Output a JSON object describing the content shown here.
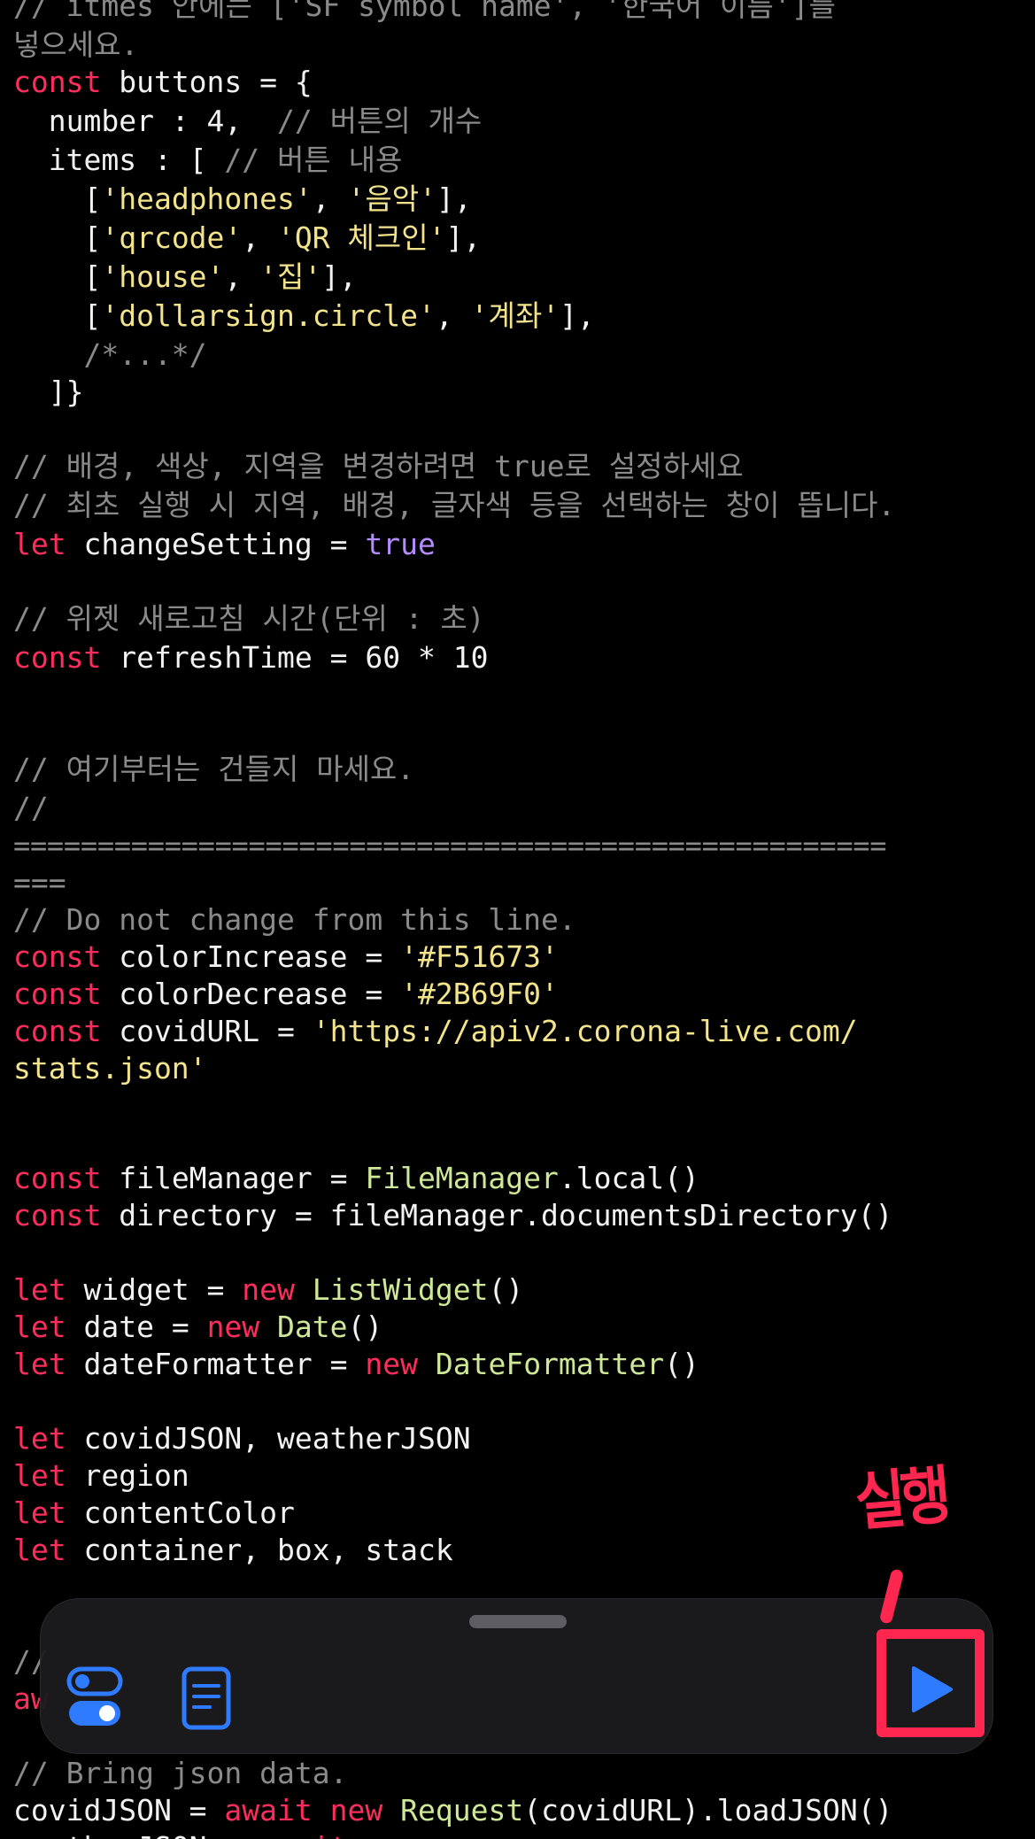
{
  "code": {
    "l01_cmt": "// itmes 안에는 ['SF symbol name', '한국어 이름']를",
    "l02_cmt": "넣으세요.",
    "l03_kw": "const",
    "l03_rest": " buttons = {",
    "l04_plain": "  number : 4,  ",
    "l04_cmt": "// 버튼의 개수",
    "l05_plain": "  items : [ ",
    "l05_cmt": "// 버튼 내용",
    "l06_a": "    [",
    "l06_s1": "'headphones'",
    "l06_b": ", ",
    "l06_s2": "'음악'",
    "l06_c": "],",
    "l07_a": "    [",
    "l07_s1": "'qrcode'",
    "l07_b": ", ",
    "l07_s2": "'QR 체크인'",
    "l07_c": "],",
    "l08_a": "    [",
    "l08_s1": "'house'",
    "l08_b": ", ",
    "l08_s2": "'집'",
    "l08_c": "],",
    "l09_a": "    [",
    "l09_s1": "'dollarsign.circle'",
    "l09_b": ", ",
    "l09_s2": "'계좌'",
    "l09_c": "],",
    "l10_cmt": "    /*...*/",
    "l11_plain": "  ]}",
    "l12_cmt": "// 배경, 색상, 지역을 변경하려면 true로 설정하세요",
    "l13_cmt": "// 최초 실행 시 지역, 배경, 글자색 등을 선택하는 창이 뜹니다.",
    "l14_kw": "let",
    "l14_plain": " changeSetting = ",
    "l14_bool": "true",
    "l15_cmt": "// 위젯 새로고침 시간(단위 : 초)",
    "l16_kw": "const",
    "l16_plain": " refreshTime = 60 * 10",
    "l17_cmt": "// 여기부터는 건들지 마세요.",
    "l18_cmt": "//",
    "l19_cmt": "====================================================",
    "l20_cmt": "===",
    "l21_cmt": "// Do not change from this line.",
    "l22_kw": "const",
    "l22_plain": " colorIncrease = ",
    "l22_str": "'#F51673'",
    "l23_kw": "const",
    "l23_plain": " colorDecrease = ",
    "l23_str": "'#2B69F0'",
    "l24_kw": "const",
    "l24_plain": " covidURL = ",
    "l24_str": "'https://apiv2.corona-live.com/",
    "l25_str": "stats.json'",
    "l26_kw": "const",
    "l26_plain": " fileManager = ",
    "l26_cls": "FileManager",
    "l26_tail": ".local()",
    "l27_kw": "const",
    "l27_plain": " directory = fileManager.documentsDirectory()",
    "l28_kw": "let",
    "l28_plain": " widget = ",
    "l28_kw2": "new",
    "l28_sp": " ",
    "l28_cls": "ListWidget",
    "l28_tail": "()",
    "l29_kw": "let",
    "l29_plain": " date = ",
    "l29_kw2": "new",
    "l29_sp": " ",
    "l29_cls": "Date",
    "l29_tail": "()",
    "l30_kw": "let",
    "l30_plain": " dateFormatter = ",
    "l30_kw2": "new",
    "l30_sp": " ",
    "l30_cls": "DateFormatter",
    "l30_tail": "()",
    "l31_kw": "let",
    "l31_plain": " covidJSON, weatherJSON",
    "l32_kw": "let",
    "l32_plain": " region",
    "l33_kw": "let",
    "l33_plain": " contentColor",
    "l34_kw": "let",
    "l34_plain": " container, box, stack",
    "l35_cmt": "//",
    "l36_kw": "aw",
    "l37_cmt": "// Bring json data.",
    "l38_plain": "covidJSON = ",
    "l38_kw": "await",
    "l38_sp": " ",
    "l38_kw2": "new",
    "l38_sp2": " ",
    "l38_cls": "Request",
    "l38_tail": "(covidURL).loadJSON()",
    "l39_plain": "weatherJSON = ",
    "l39_kw": "await"
  },
  "toolbar": {
    "settings_icon": "toggle-settings-icon",
    "log_icon": "document-log-icon",
    "run_icon": "play-icon",
    "accent": "#2f7bff"
  },
  "annotation": {
    "label": "실행",
    "color": "#ff2750"
  }
}
